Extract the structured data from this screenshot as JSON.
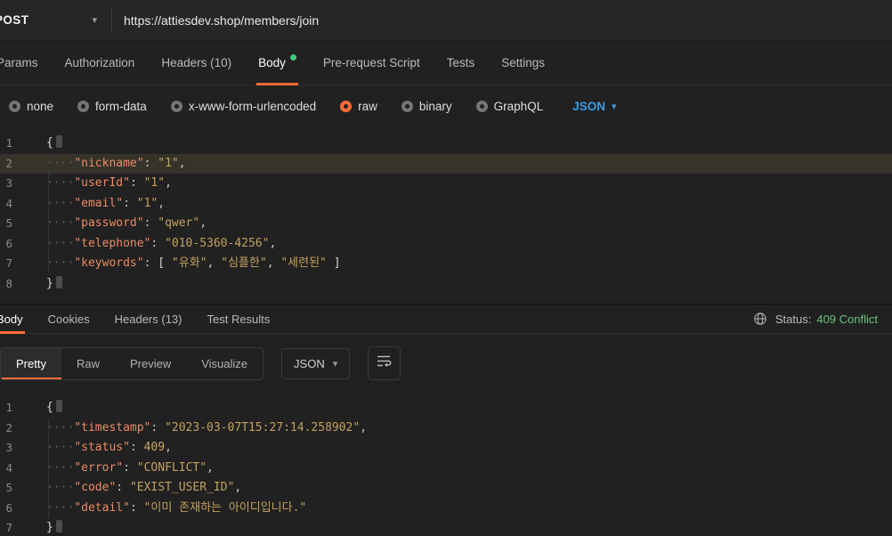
{
  "request": {
    "method": "POST",
    "url": "https://attiesdev.shop/members/join",
    "tabs": [
      {
        "label": "Params"
      },
      {
        "label": "Authorization"
      },
      {
        "label": "Headers (10)"
      },
      {
        "label": "Body"
      },
      {
        "label": "Pre-request Script"
      },
      {
        "label": "Tests"
      },
      {
        "label": "Settings"
      }
    ],
    "body_types": [
      {
        "label": "none",
        "selected": false
      },
      {
        "label": "form-data",
        "selected": false
      },
      {
        "label": "x-www-form-urlencoded",
        "selected": false
      },
      {
        "label": "raw",
        "selected": true
      },
      {
        "label": "binary",
        "selected": false
      },
      {
        "label": "GraphQL",
        "selected": false
      }
    ],
    "language": "JSON"
  },
  "request_editor": {
    "lines": [
      {
        "n": 1,
        "fold": true,
        "t": [
          {
            "c": "brace",
            "v": "{"
          }
        ]
      },
      {
        "n": 2,
        "h": true,
        "t": [
          {
            "c": "ws",
            "v": "····"
          },
          {
            "c": "key",
            "v": "\"nickname\""
          },
          {
            "c": "pun",
            "v": ": "
          },
          {
            "c": "str",
            "v": "\"1\""
          },
          {
            "c": "pun",
            "v": ","
          }
        ]
      },
      {
        "n": 3,
        "t": [
          {
            "c": "ws",
            "v": "····"
          },
          {
            "c": "key",
            "v": "\"userId\""
          },
          {
            "c": "pun",
            "v": ": "
          },
          {
            "c": "str",
            "v": "\"1\""
          },
          {
            "c": "pun",
            "v": ","
          }
        ]
      },
      {
        "n": 4,
        "t": [
          {
            "c": "ws",
            "v": "····"
          },
          {
            "c": "key",
            "v": "\"email\""
          },
          {
            "c": "pun",
            "v": ": "
          },
          {
            "c": "str",
            "v": "\"1\""
          },
          {
            "c": "pun",
            "v": ","
          }
        ]
      },
      {
        "n": 5,
        "t": [
          {
            "c": "ws",
            "v": "····"
          },
          {
            "c": "key",
            "v": "\"password\""
          },
          {
            "c": "pun",
            "v": ": "
          },
          {
            "c": "str",
            "v": "\"qwer\""
          },
          {
            "c": "pun",
            "v": ","
          }
        ]
      },
      {
        "n": 6,
        "t": [
          {
            "c": "ws",
            "v": "····"
          },
          {
            "c": "key",
            "v": "\"telephone\""
          },
          {
            "c": "pun",
            "v": ": "
          },
          {
            "c": "str",
            "v": "\"010-5360-4256\""
          },
          {
            "c": "pun",
            "v": ","
          }
        ]
      },
      {
        "n": 7,
        "t": [
          {
            "c": "ws",
            "v": "····"
          },
          {
            "c": "key",
            "v": "\"keywords\""
          },
          {
            "c": "pun",
            "v": ": "
          },
          {
            "c": "brk",
            "v": "[ "
          },
          {
            "c": "str",
            "v": "\"유화\""
          },
          {
            "c": "pun",
            "v": ", "
          },
          {
            "c": "str",
            "v": "\"심플한\""
          },
          {
            "c": "pun",
            "v": ", "
          },
          {
            "c": "str",
            "v": "\"세련된\""
          },
          {
            "c": "brk",
            "v": " ]"
          }
        ]
      },
      {
        "n": 8,
        "fold": true,
        "t": [
          {
            "c": "brace",
            "v": "}"
          }
        ]
      }
    ]
  },
  "response": {
    "tabs": [
      {
        "label": "Body"
      },
      {
        "label": "Cookies"
      },
      {
        "label": "Headers (13)"
      },
      {
        "label": "Test Results"
      }
    ],
    "status_label": "Status:",
    "status_value": "409 Conflict",
    "views": [
      {
        "label": "Pretty"
      },
      {
        "label": "Raw"
      },
      {
        "label": "Preview"
      },
      {
        "label": "Visualize"
      }
    ],
    "language": "JSON"
  },
  "response_editor": {
    "lines": [
      {
        "n": 1,
        "fold": true,
        "t": [
          {
            "c": "brace",
            "v": "{"
          }
        ]
      },
      {
        "n": 2,
        "t": [
          {
            "c": "ws",
            "v": "····"
          },
          {
            "c": "key",
            "v": "\"timestamp\""
          },
          {
            "c": "pun",
            "v": ": "
          },
          {
            "c": "str",
            "v": "\"2023-03-07T15:27:14.258902\""
          },
          {
            "c": "pun",
            "v": ","
          }
        ]
      },
      {
        "n": 3,
        "t": [
          {
            "c": "ws",
            "v": "····"
          },
          {
            "c": "key",
            "v": "\"status\""
          },
          {
            "c": "pun",
            "v": ": "
          },
          {
            "c": "num",
            "v": "409"
          },
          {
            "c": "pun",
            "v": ","
          }
        ]
      },
      {
        "n": 4,
        "t": [
          {
            "c": "ws",
            "v": "····"
          },
          {
            "c": "key",
            "v": "\"error\""
          },
          {
            "c": "pun",
            "v": ": "
          },
          {
            "c": "str",
            "v": "\"CONFLICT\""
          },
          {
            "c": "pun",
            "v": ","
          }
        ]
      },
      {
        "n": 5,
        "t": [
          {
            "c": "ws",
            "v": "····"
          },
          {
            "c": "key",
            "v": "\"code\""
          },
          {
            "c": "pun",
            "v": ": "
          },
          {
            "c": "str",
            "v": "\"EXIST_USER_ID\""
          },
          {
            "c": "pun",
            "v": ","
          }
        ]
      },
      {
        "n": 6,
        "t": [
          {
            "c": "ws",
            "v": "····"
          },
          {
            "c": "key",
            "v": "\"detail\""
          },
          {
            "c": "pun",
            "v": ": "
          },
          {
            "c": "str",
            "v": "\"이미 존재하는 아이디입니다.\""
          }
        ]
      },
      {
        "n": 7,
        "fold": true,
        "t": [
          {
            "c": "brace",
            "v": "}"
          }
        ]
      }
    ]
  }
}
